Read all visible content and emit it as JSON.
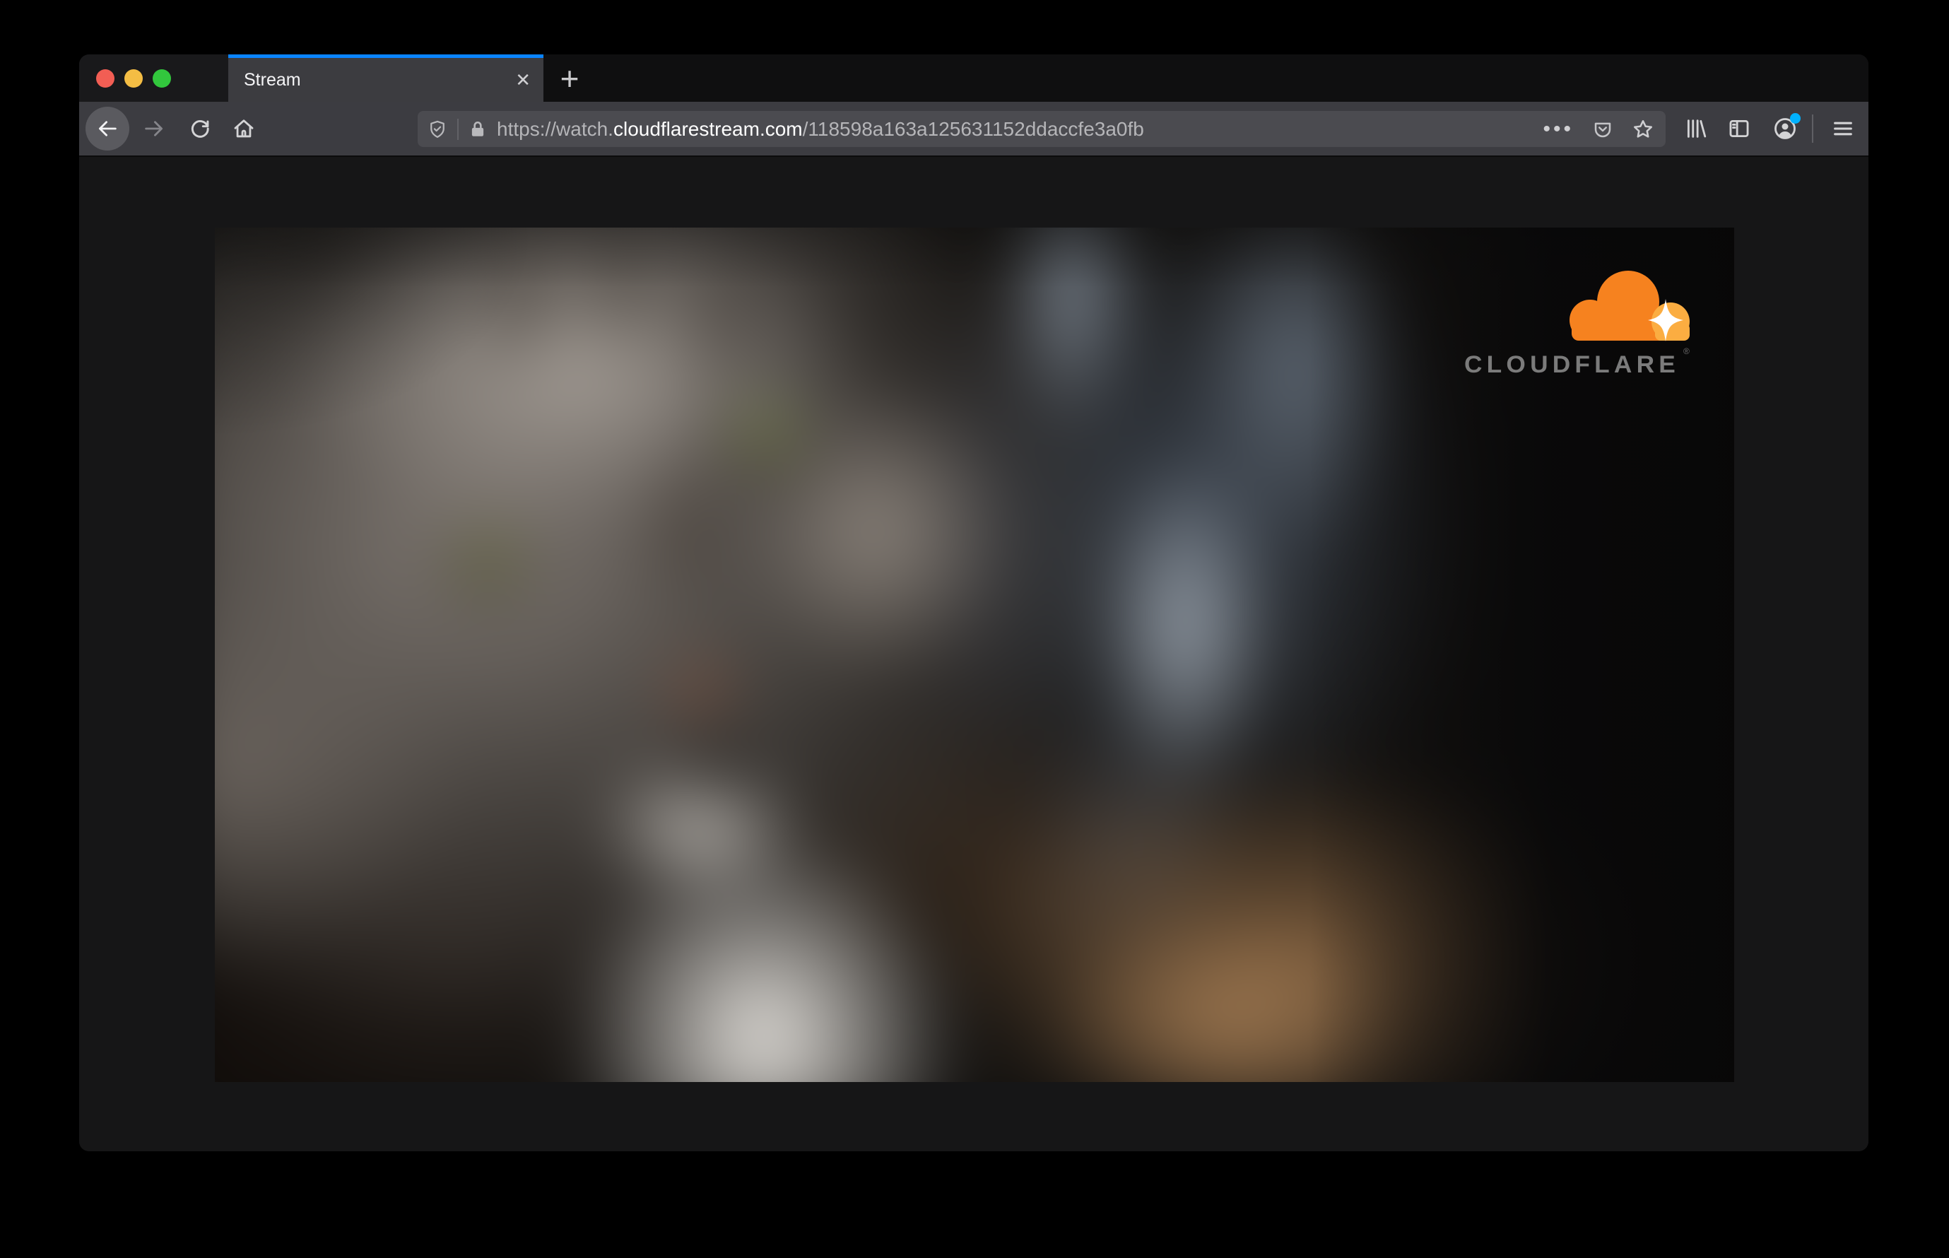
{
  "browser": {
    "window_controls": {
      "close": "window-close",
      "minimize": "window-minimize",
      "zoom": "window-zoom"
    },
    "tab": {
      "title": "Stream",
      "close_glyph": "✕"
    },
    "new_tab_glyph": "+",
    "toolbar": {
      "icons": [
        "back-icon",
        "forward-icon",
        "reload-icon",
        "home-icon",
        "library-icon",
        "sidebar-icon",
        "account-icon",
        "menu-icon"
      ],
      "urlbar": {
        "icons": [
          "tracking-protection-shield-icon",
          "lock-icon",
          "page-actions-icon",
          "pocket-icon",
          "bookmark-star-icon"
        ],
        "url_prefix": "https://watch.",
        "url_domain": "cloudflarestream.com",
        "url_path": "/118598a163a125631152ddaccfe3a0fb",
        "page_actions_glyph": "•••"
      }
    }
  },
  "video": {
    "description": "blurred close-up of a gray tabby cat with green eyes",
    "brand_wordmark": "CLOUDFLARE",
    "brand_reg_mark": "®"
  },
  "colors": {
    "accent_blue": "#0a84ff",
    "traffic_red": "#f25e54",
    "traffic_yellow": "#f4bd44",
    "traffic_green": "#32c73d",
    "notification_dot": "#00b2ff",
    "cloudflare_orange": "#f6821f",
    "cloudflare_light_orange": "#fbad41",
    "wordmark_gray": "#7b7b7b"
  }
}
